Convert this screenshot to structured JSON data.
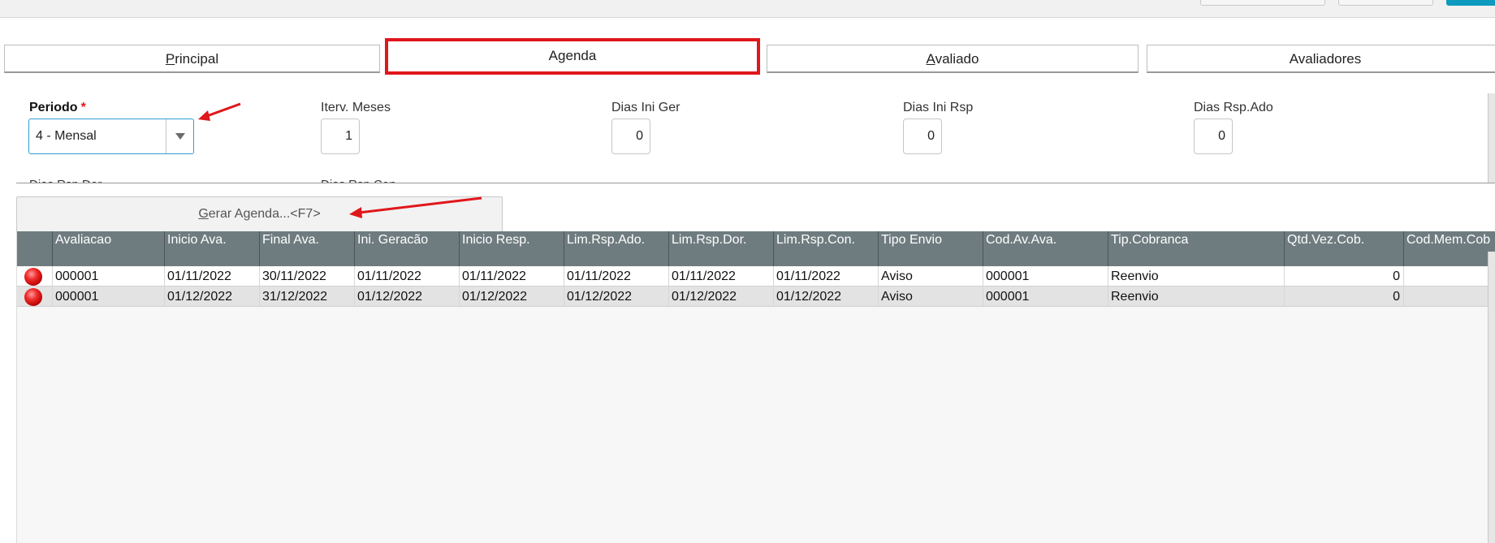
{
  "tabs": [
    {
      "accel": "P",
      "rest": "rincipal"
    },
    {
      "pre": "A",
      "accel": "g",
      "rest": "enda"
    },
    {
      "accel": "A",
      "rest": "valiado"
    },
    {
      "label": "Avaliadores"
    }
  ],
  "form": {
    "periodo": {
      "label": "Periodo",
      "required_mark": "*",
      "value": "4 - Mensal"
    },
    "iterv_meses": {
      "label": "Iterv. Meses",
      "value": "1"
    },
    "dias_ini_ger": {
      "label": "Dias Ini Ger",
      "value": "0"
    },
    "dias_ini_rsp": {
      "label": "Dias Ini Rsp",
      "value": "0"
    },
    "dias_rsp_ado": {
      "label": "Dias Rsp.Ado",
      "value": "0"
    },
    "partial_label_1": "Dias Rsp.Dor",
    "partial_label_2": "Dias Rsp.Con"
  },
  "gerar_button": {
    "accel": "G",
    "rest": "erar Agenda...<F7>"
  },
  "grid": {
    "columns": [
      "Avaliacao",
      "Inicio Ava.",
      "Final Ava.",
      "Ini. Geracão",
      "Inicio Resp.",
      "Lim.Rsp.Ado.",
      "Lim.Rsp.Dor.",
      "Lim.Rsp.Con.",
      "Tipo Envio",
      "Cod.Av.Ava.",
      "Tip.Cobranca",
      "Qtd.Vez.Cob.",
      "Cod.Mem.Cob"
    ],
    "rows": [
      [
        "000001",
        "01/11/2022",
        "30/11/2022",
        "01/11/2022",
        "01/11/2022",
        "01/11/2022",
        "01/11/2022",
        "01/11/2022",
        "Aviso",
        "000001",
        "Reenvio",
        "0",
        ""
      ],
      [
        "000001",
        "01/12/2022",
        "31/12/2022",
        "01/12/2022",
        "01/12/2022",
        "01/12/2022",
        "01/12/2022",
        "01/12/2022",
        "Aviso",
        "000001",
        "Reenvio",
        "0",
        ""
      ]
    ]
  },
  "colors": {
    "highlight": "#e0171b",
    "accent": "#2f9fcf",
    "grid_header": "#6f7c7f"
  },
  "icons": {
    "status": "red-status-icon",
    "dropdown": "chevron-down-icon"
  }
}
